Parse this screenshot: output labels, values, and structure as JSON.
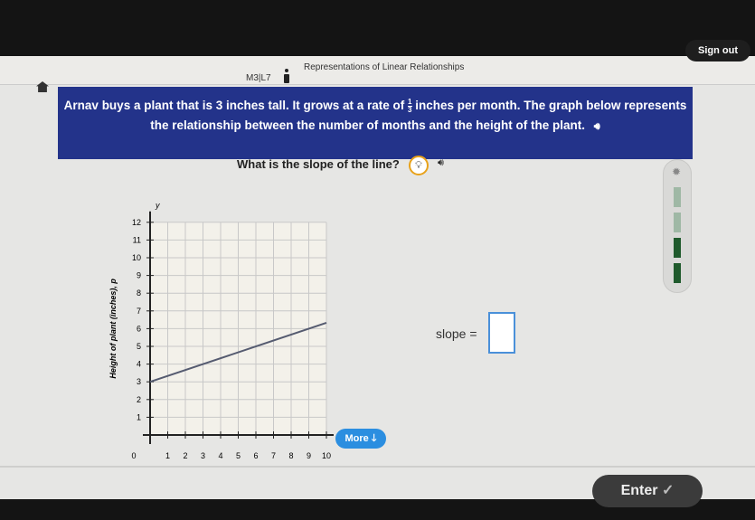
{
  "header": {
    "lesson_code": "M3|L7",
    "lesson_title": "Representations of Linear Relationships",
    "sign_out": "Sign out"
  },
  "problem": {
    "text_before": "Arnav buys a plant that is 3 inches tall. It grows at a rate of",
    "fraction_num": "1",
    "fraction_den": "3",
    "text_after": "inches per month. The graph below represents the relationship between the number of months and the height of the plant."
  },
  "question": "What is the slope of the line?",
  "answer": {
    "label": "slope =",
    "value": ""
  },
  "buttons": {
    "more": "More",
    "enter": "Enter"
  },
  "icons": [
    "home-icon",
    "info-icon",
    "speaker-icon",
    "lightbulb-icon",
    "star-icon",
    "arrow-down-icon",
    "check-icon"
  ],
  "colors": {
    "banner": "#23338a",
    "more_button": "#2b8ee0",
    "hint_ring": "#e8a21a",
    "progress": "#1f5a2c"
  },
  "progress": {
    "segments_total": 4,
    "segments_filled": 2
  },
  "chart_data": {
    "type": "line",
    "title": "",
    "xlabel": "",
    "ylabel": "Height of plant (inches), p",
    "y_axis_letter": "y",
    "xlim": [
      0,
      10
    ],
    "ylim": [
      0,
      12
    ],
    "x_ticks": [
      "0",
      "1",
      "2",
      "3",
      "4",
      "5",
      "6",
      "7",
      "8",
      "9",
      "10"
    ],
    "y_ticks": [
      "1",
      "2",
      "3",
      "4",
      "5",
      "6",
      "7",
      "8",
      "9",
      "10",
      "11",
      "12"
    ],
    "grid": true,
    "series": [
      {
        "x": [
          0,
          10
        ],
        "y": [
          3,
          6.33
        ]
      }
    ]
  }
}
